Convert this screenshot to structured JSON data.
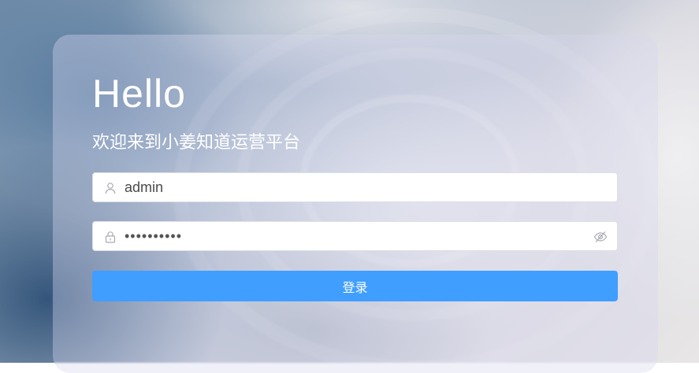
{
  "login": {
    "title": "Hello",
    "subtitle": "欢迎来到小姜知道运营平台",
    "username_value": "admin",
    "password_value": "••••••••••",
    "submit_label": "登录"
  },
  "icons": {
    "username": "user-icon",
    "password": "lock-icon",
    "toggle": "eye-off-icon"
  },
  "colors": {
    "primary_button": "#409eff",
    "text_white": "#ffffff",
    "input_border": "#dcdfe6",
    "icon_gray": "#a8abb2"
  }
}
